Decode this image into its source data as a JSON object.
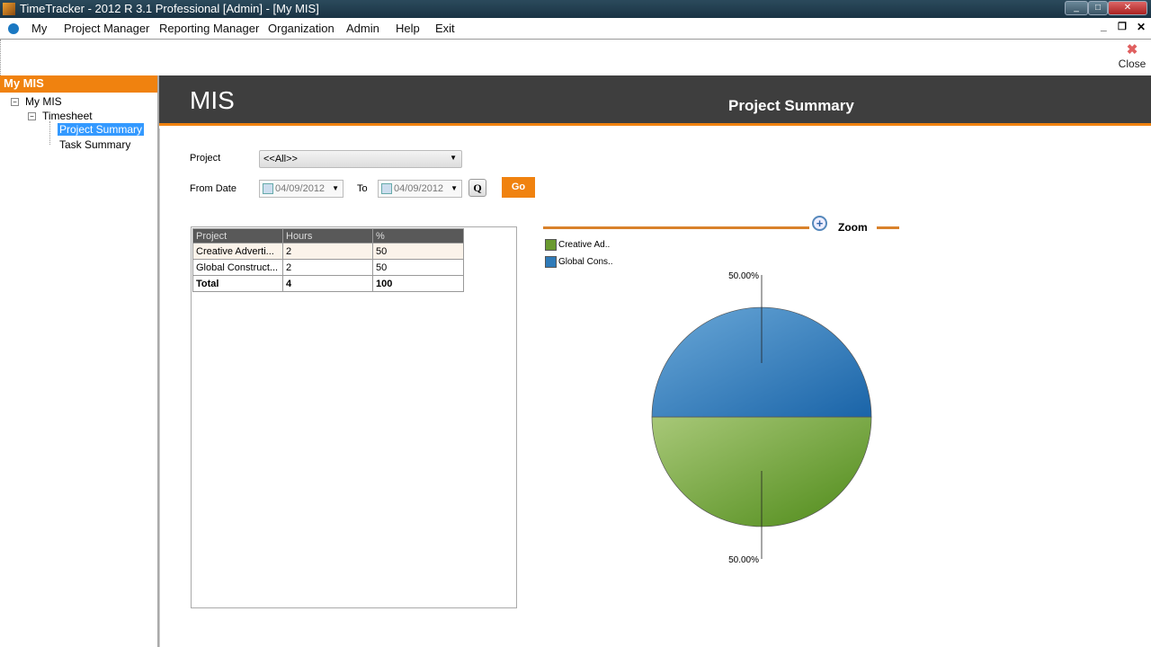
{
  "window": {
    "title": "TimeTracker - 2012 R 3.1 Professional [Admin] - [My MIS]"
  },
  "menu": [
    "My",
    "Project Manager",
    "Reporting Manager",
    "Organization",
    "Admin",
    "Help",
    "Exit"
  ],
  "toolbar": {
    "close_label": "Close"
  },
  "sidebar": {
    "header": "My MIS",
    "tree": {
      "root": "My MIS",
      "timesheet": "Timesheet",
      "project_summary": "Project Summary",
      "task_summary": "Task Summary"
    }
  },
  "header": {
    "title": "MIS",
    "subtitle": "Project Summary"
  },
  "filters": {
    "project_label": "Project",
    "project_value": "<<All>>",
    "from_label": "From Date",
    "from_value": "04/09/2012",
    "to_label": "To",
    "to_value": "04/09/2012",
    "q_label": "Q",
    "go_label": "Go"
  },
  "table": {
    "headers": [
      "Project",
      "Hours",
      "%"
    ],
    "rows": [
      [
        "Creative Adverti...",
        "2",
        "50"
      ],
      [
        "Global Construct...",
        "2",
        "50"
      ]
    ],
    "total": [
      "Total",
      "4",
      "100"
    ]
  },
  "chart_data": {
    "type": "pie",
    "zoom_label": "Zoom",
    "labels": [
      "Creative Ad..",
      "Global Cons.."
    ],
    "values": [
      50,
      50
    ],
    "data_labels": [
      "50.00%",
      "50.00%"
    ],
    "colors": [
      "#6a9a30",
      "#2f7ab8"
    ],
    "legend": "top-left"
  }
}
